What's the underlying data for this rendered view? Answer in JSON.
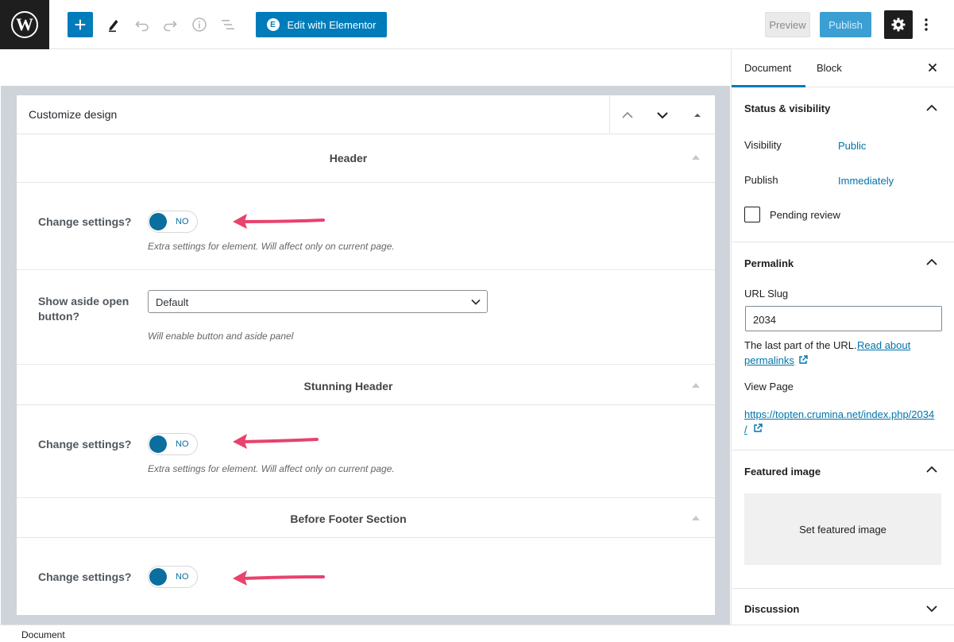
{
  "toolbar": {
    "logo_letter": "W",
    "add_symbol": "+",
    "elementor_label": "Edit with Elementor",
    "elementor_icon_letter": "E",
    "preview_label": "Preview",
    "publish_label": "Publish"
  },
  "panel": {
    "title": "Customize design",
    "sections": {
      "header": "Header",
      "stunning_header": "Stunning Header",
      "before_footer": "Before Footer Section"
    },
    "rows": {
      "header_change": {
        "label": "Change settings?",
        "toggle": "NO",
        "hint": "Extra settings for element. Will affect only on current page."
      },
      "aside": {
        "label_line1": "Show aside open",
        "label_line2": "button?",
        "value": "Default",
        "hint": "Will enable button and aside panel"
      },
      "stunning_change": {
        "label": "Change settings?",
        "toggle": "NO",
        "hint": "Extra settings for element. Will affect only on current page."
      },
      "footer_change": {
        "label": "Change settings?",
        "toggle": "NO"
      }
    },
    "colors": {
      "arrow": "#e8426d",
      "toggle": "#0a6e9e"
    }
  },
  "sidebar": {
    "tabs": {
      "document": "Document",
      "block": "Block"
    },
    "status": {
      "title": "Status & visibility",
      "visibility_label": "Visibility",
      "visibility_value": "Public",
      "publish_label": "Publish",
      "publish_value": "Immediately",
      "pending_label": "Pending review"
    },
    "permalink": {
      "title": "Permalink",
      "slug_label": "URL Slug",
      "slug_value": "2034",
      "help_text": "The last part of the URL.",
      "help_link_1": "Read about",
      "help_link_2": "permalinks",
      "view_label": "View Page",
      "url_line1": "https://topten.crumina.net/index.php/2034",
      "url_line2": "/"
    },
    "featured": {
      "title": "Featured image",
      "button": "Set featured image"
    },
    "discussion": {
      "title": "Discussion"
    }
  },
  "footer": {
    "breadcrumb": "Document"
  }
}
